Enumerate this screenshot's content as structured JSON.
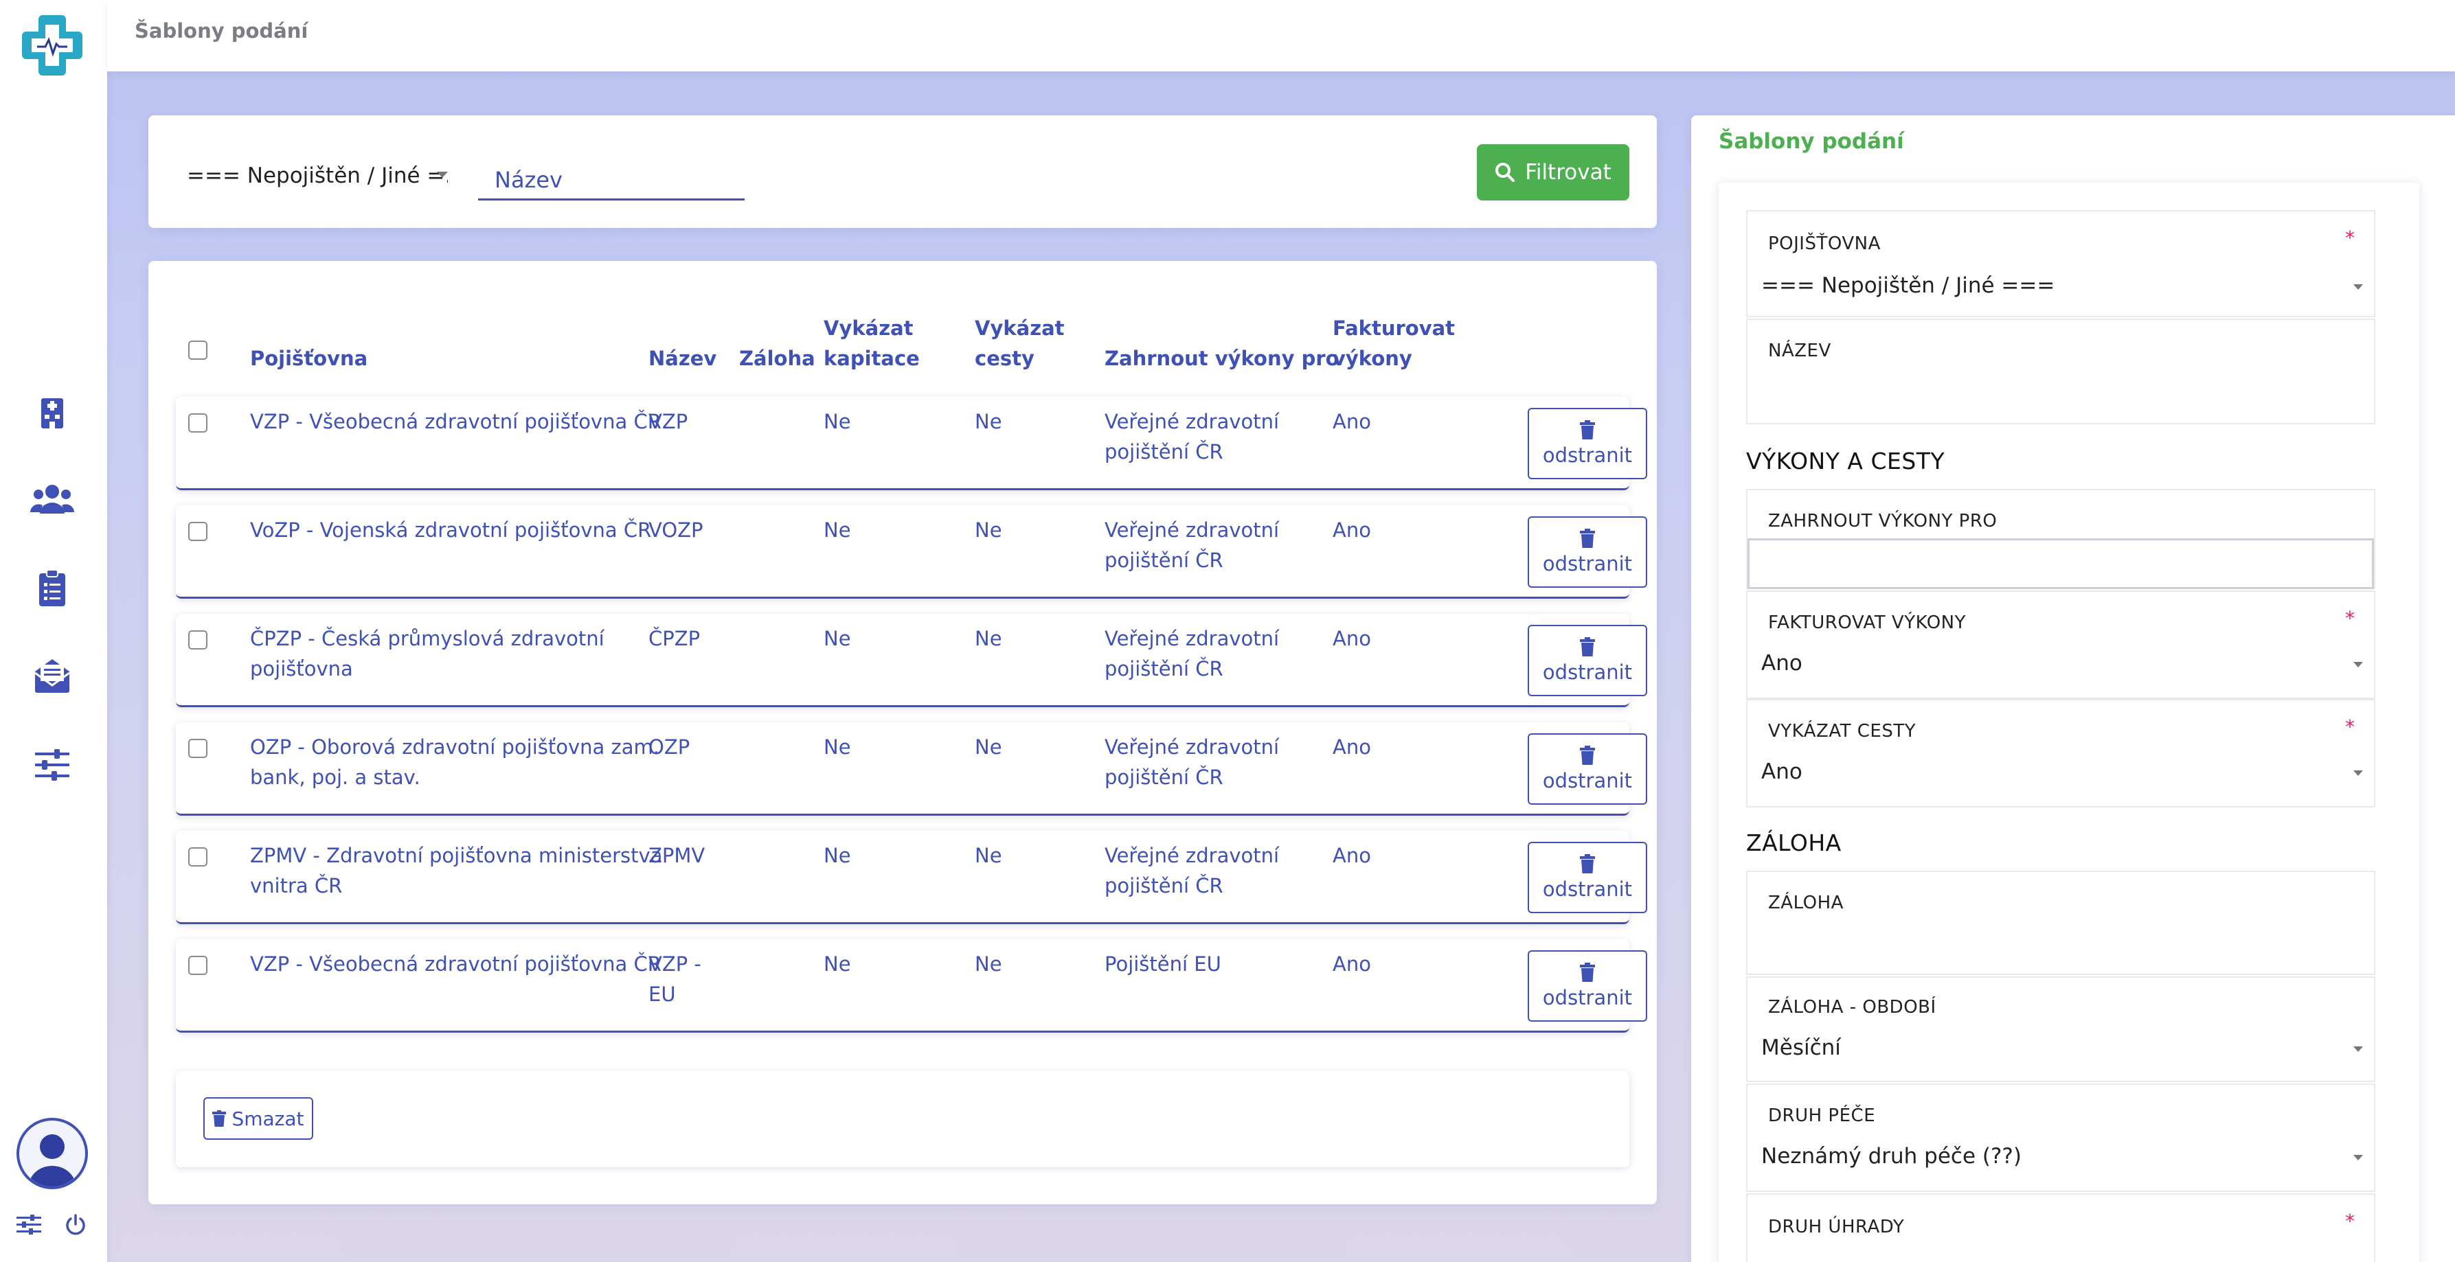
{
  "topbar": {
    "title": "Šablony podání"
  },
  "filter": {
    "insurer_select": "=== Nepojištěn / Jiné =…",
    "name_placeholder": "Název",
    "button_label": "Filtrovat"
  },
  "table": {
    "headers": {
      "insurer": "Pojišťovna",
      "name": "Název",
      "deposit": "Záloha",
      "report_capitation_1": "Vykázat",
      "report_capitation_2": "kapitace",
      "report_trips_1": "Vykázat",
      "report_trips_2": "cesty",
      "include_for": "Zahrnout výkony pro",
      "invoice_1": "Fakturovat",
      "invoice_2": "výkony"
    },
    "delete_label": "odstranit",
    "rows": [
      {
        "insurer_1": "VZP - Všeobecná zdravotní pojišťovna ČR",
        "insurer_2": "",
        "name_1": "VZP",
        "name_2": "",
        "deposit": "",
        "capitation": "Ne",
        "trips": "Ne",
        "include_1": "Veřejné zdravotní",
        "include_2": "pojištění ČR",
        "invoice": "Ano"
      },
      {
        "insurer_1": "VoZP - Vojenská zdravotní pojišťovna ČR",
        "insurer_2": "",
        "name_1": "VOZP",
        "name_2": "",
        "deposit": "",
        "capitation": "Ne",
        "trips": "Ne",
        "include_1": "Veřejné zdravotní",
        "include_2": "pojištění ČR",
        "invoice": "Ano"
      },
      {
        "insurer_1": "ČPZP - Česká průmyslová zdravotní",
        "insurer_2": "pojišťovna",
        "name_1": "ČPZP",
        "name_2": "",
        "deposit": "",
        "capitation": "Ne",
        "trips": "Ne",
        "include_1": "Veřejné zdravotní",
        "include_2": "pojištění ČR",
        "invoice": "Ano"
      },
      {
        "insurer_1": "OZP - Oborová zdravotní pojišťovna zam.",
        "insurer_2": "bank, poj. a stav.",
        "name_1": "OZP",
        "name_2": "",
        "deposit": "",
        "capitation": "Ne",
        "trips": "Ne",
        "include_1": "Veřejné zdravotní",
        "include_2": "pojištění ČR",
        "invoice": "Ano"
      },
      {
        "insurer_1": "ZPMV - Zdravotní pojišťovna ministerstva",
        "insurer_2": "vnitra ČR",
        "name_1": "ZPMV",
        "name_2": "",
        "deposit": "",
        "capitation": "Ne",
        "trips": "Ne",
        "include_1": "Veřejné zdravotní",
        "include_2": "pojištění ČR",
        "invoice": "Ano"
      },
      {
        "insurer_1": "VZP - Všeobecná zdravotní pojišťovna ČR",
        "insurer_2": "",
        "name_1": "VZP -",
        "name_2": "EU",
        "deposit": "",
        "capitation": "Ne",
        "trips": "Ne",
        "include_1": "Pojištění EU",
        "include_2": "",
        "invoice": "Ano"
      }
    ],
    "bulk_delete_label": "Smazat"
  },
  "panel": {
    "title": "Šablony podání",
    "insurer_label": "POJIŠŤOVNA",
    "insurer_value": "=== Nepojištěn / Jiné ===",
    "name_label": "NÁZEV",
    "name_value": "",
    "section_services": "VÝKONY A CESTY",
    "include_label": "ZAHRNOUT VÝKONY PRO",
    "include_value": "",
    "invoice_label": "FAKTUROVAT VÝKONY",
    "invoice_value": "Ano",
    "trips_label": "VYKÁZAT CESTY",
    "trips_value": "Ano",
    "section_deposit": "ZÁLOHA",
    "deposit_label": "ZÁLOHA",
    "deposit_value": "",
    "deposit_period_label": "ZÁLOHA - OBDOBÍ",
    "deposit_period_value": "Měsíční",
    "care_type_label": "DRUH PÉČE",
    "care_type_value": "Neznámý druh péče (??)",
    "payment_type_label": "DRUH ÚHRADY",
    "required_mark": "*"
  },
  "colors": {
    "primary": "#3f51b5",
    "success": "#4caf50",
    "required": "#e91e63"
  },
  "icons": [
    "logo-icon",
    "hospital-icon",
    "users-icon",
    "clipboard-icon",
    "mail-icon",
    "sliders-icon",
    "avatar-icon",
    "settings-icon",
    "power-icon",
    "search-icon",
    "trash-icon"
  ]
}
